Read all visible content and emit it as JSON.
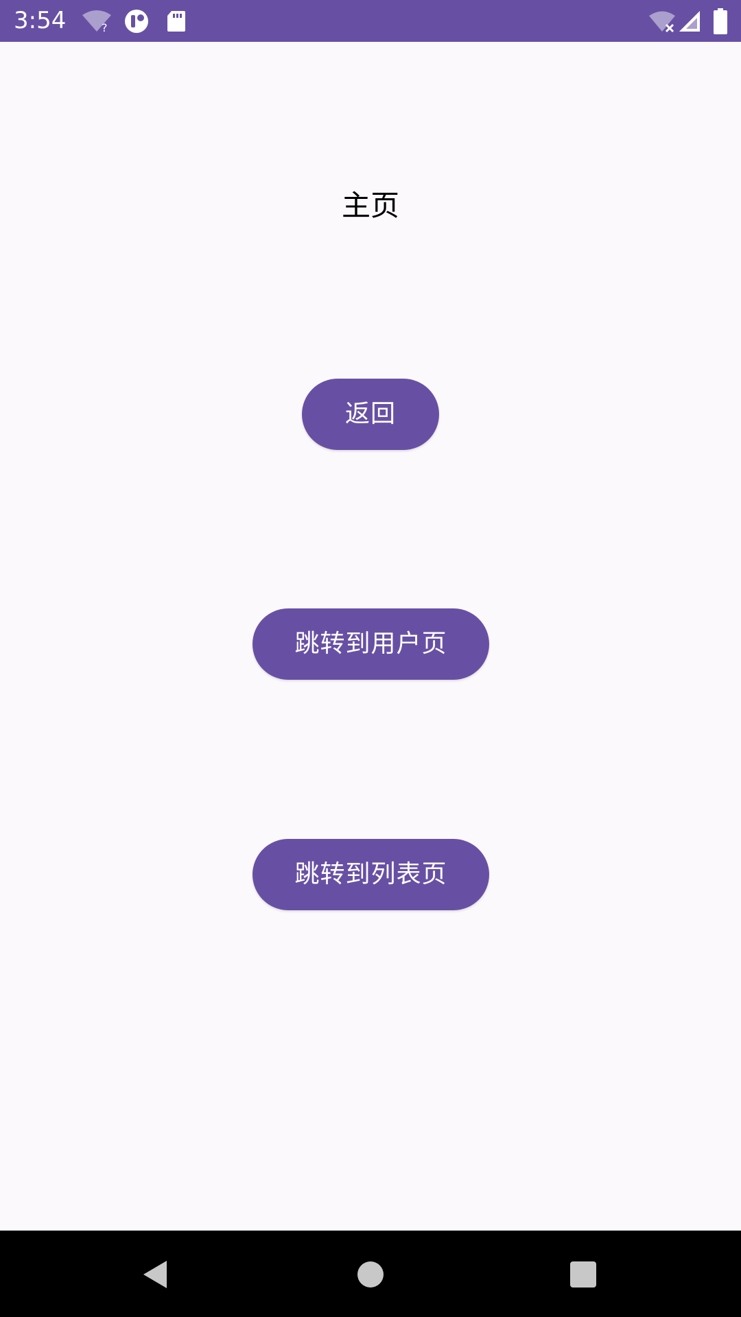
{
  "status_bar": {
    "time": "3:54",
    "background_color": "#6750a4",
    "left_icons": [
      "wifi-question-icon",
      "round-app-icon",
      "sd-card-icon"
    ],
    "right_icons": [
      "wifi-no-internet-icon",
      "cell-signal-icon",
      "battery-icon"
    ]
  },
  "main": {
    "title": "主页",
    "buttons": [
      {
        "label": "返回"
      },
      {
        "label": "跳转到用户页"
      },
      {
        "label": "跳转到列表页"
      }
    ],
    "button_color": "#6750a4",
    "background_color": "#fcf9fd"
  },
  "nav_bar": {
    "icons": [
      "back-icon",
      "home-icon",
      "recents-icon"
    ]
  }
}
